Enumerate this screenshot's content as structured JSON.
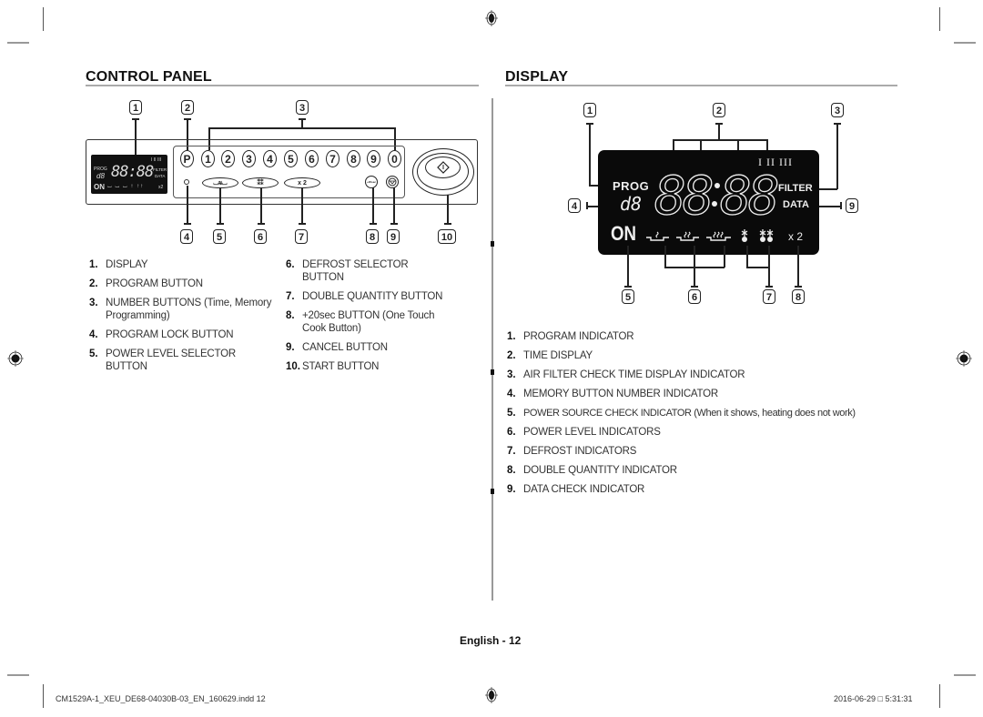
{
  "control_panel": {
    "title": "CONTROL PANEL",
    "callouts": [
      "1",
      "2",
      "3",
      "4",
      "5",
      "6",
      "7",
      "8",
      "9",
      "10"
    ],
    "mini_display": {
      "prog": "PROG",
      "memory": "d8",
      "time": "88:88",
      "roman": "I II III",
      "filter": "FILTER",
      "data": "DATA",
      "on": "ON",
      "x2": "x2"
    },
    "buttons": {
      "program": "P",
      "numbers": [
        "1",
        "2",
        "3",
        "4",
        "5",
        "6",
        "7",
        "8",
        "9",
        "0"
      ],
      "double_quantity": "x 2",
      "plus20": "+20sec"
    },
    "legend_left": [
      {
        "num": "1.",
        "text": "DISPLAY"
      },
      {
        "num": "2.",
        "text": "PROGRAM BUTTON"
      },
      {
        "num": "3.",
        "text": "NUMBER BUTTONS (Time, Memory Programming)"
      },
      {
        "num": "4.",
        "text": "PROGRAM LOCK BUTTON"
      },
      {
        "num": "5.",
        "text": "POWER LEVEL SELECTOR BUTTON"
      }
    ],
    "legend_right": [
      {
        "num": "6.",
        "text": "DEFROST SELECTOR BUTTON"
      },
      {
        "num": "7.",
        "text": "DOUBLE QUANTITY BUTTON"
      },
      {
        "num": "8.",
        "text": "+20sec BUTTON (One Touch Cook Button)"
      },
      {
        "num": "9.",
        "text": "CANCEL BUTTON"
      },
      {
        "num": "10.",
        "text": "START BUTTON"
      }
    ]
  },
  "display": {
    "title": "DISPLAY",
    "callouts": [
      "1",
      "2",
      "3",
      "4",
      "5",
      "6",
      "7",
      "8",
      "9"
    ],
    "lcd": {
      "prog": "PROG",
      "memory": "d8",
      "time_left": "88",
      "time_right": "88",
      "roman": "I II III",
      "filter": "FILTER",
      "data": "DATA",
      "on": "ON",
      "x2": "x 2"
    },
    "legend": [
      {
        "num": "1.",
        "text": "PROGRAM INDICATOR"
      },
      {
        "num": "2.",
        "text": "TIME DISPLAY"
      },
      {
        "num": "3.",
        "text": "AIR FILTER CHECK TIME DISPLAY INDICATOR"
      },
      {
        "num": "4.",
        "text": "MEMORY BUTTON NUMBER INDICATOR"
      },
      {
        "num": "5.",
        "text": "POWER SOURCE CHECK INDICATOR (When it shows, heating does not work)"
      },
      {
        "num": "6.",
        "text": "POWER LEVEL INDICATORS"
      },
      {
        "num": "7.",
        "text": "DEFROST INDICATORS"
      },
      {
        "num": "8.",
        "text": "DOUBLE QUANTITY INDICATOR"
      },
      {
        "num": "9.",
        "text": "DATA CHECK INDICATOR"
      }
    ]
  },
  "page_label": "English - 12",
  "footer": {
    "file": "CM1529A-1_XEU_DE68-04030B-03_EN_160629.indd   12",
    "timestamp": "2016-06-29   □ 5:31:31"
  }
}
